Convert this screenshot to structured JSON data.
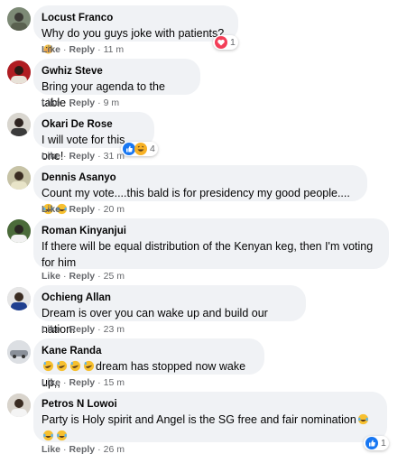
{
  "comments": [
    {
      "name": "Locust Franco",
      "text": "Why do you guys joke with patients?",
      "like": "Like",
      "reply": "Reply",
      "time": "11 m",
      "reactions": {
        "count": "1",
        "icons": [
          "love"
        ]
      },
      "text_emojis": [
        "facepalm"
      ]
    },
    {
      "name": "Gwhiz Steve",
      "text": "Bring your agenda to the table .",
      "like": "Like",
      "reply": "Reply",
      "time": "9 m"
    },
    {
      "name": "Okari De Rose",
      "text": "I will vote for this one!",
      "like": "Like",
      "reply": "Reply",
      "time": "31 m",
      "reactions": {
        "count": "4",
        "icons": [
          "like",
          "haha"
        ]
      }
    },
    {
      "name": "Dennis Asanyo",
      "text": "Count my vote....this bald is for presidency my good people....",
      "like": "Like",
      "reply": "Reply",
      "time": "20 m",
      "text_emojis": [
        "laughing-tears",
        "laughing-tears"
      ]
    },
    {
      "name": "Roman Kinyanjui",
      "text": "If there will be equal distribution of the Kenyan keg, then I'm voting for him",
      "like": "Like",
      "reply": "Reply",
      "time": "25 m"
    },
    {
      "name": "Ochieng Allan",
      "text": "Dream is over you can wake up and build our nation.",
      "like": "Like",
      "reply": "Reply",
      "time": "23 m"
    },
    {
      "name": "Kane Randa",
      "text": "dream has stopped now wake up,,",
      "like": "Like",
      "reply": "Reply",
      "time": "15 m",
      "leading_emojis": [
        "rofl",
        "rofl",
        "rofl",
        "rofl"
      ]
    },
    {
      "name": "Petros N Lowoi",
      "text": "Party is Holy spirit and Angel is the SG free and fair nomination",
      "like": "Like",
      "reply": "Reply",
      "time": "26 m",
      "reactions": {
        "count": "1",
        "icons": [
          "like"
        ]
      },
      "text_emojis": [
        "laughing-tears",
        "laughing-tears",
        "laughing-tears"
      ]
    }
  ],
  "colors": {
    "bubble": "#f0f2f5",
    "meta_text": "#65676b",
    "like_blue": "#1877f2",
    "love_red": "#f33e58",
    "haha_yellow": "#f7b125"
  }
}
